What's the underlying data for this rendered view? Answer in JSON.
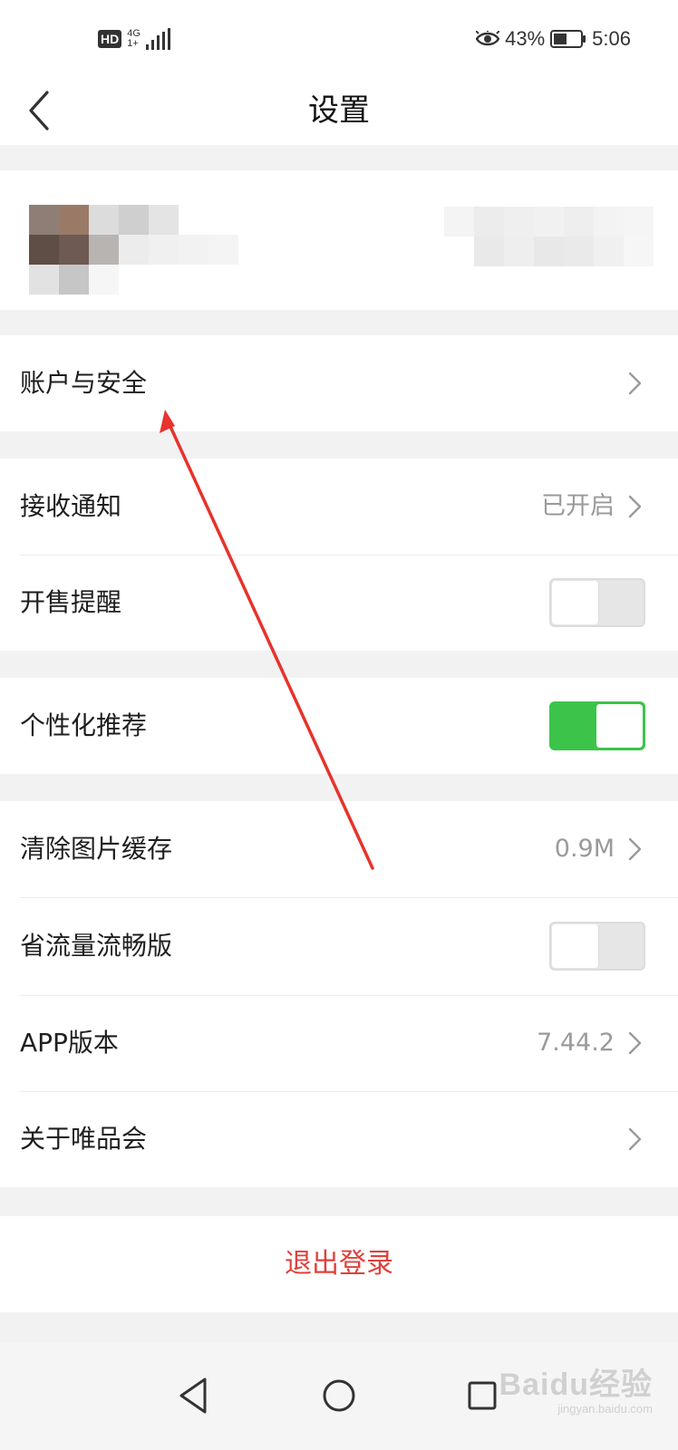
{
  "status_bar": {
    "hd": "HD",
    "network_top": "4G",
    "network_bottom": "1+",
    "battery_percent": "43%",
    "time": "5:06"
  },
  "header": {
    "title": "设置"
  },
  "sections": {
    "account": {
      "label": "账户与安全"
    },
    "notifications": {
      "receive_label": "接收通知",
      "receive_value": "已开启",
      "presale_label": "开售提醒",
      "presale_on": false
    },
    "personalized": {
      "label": "个性化推荐",
      "on": true
    },
    "misc": {
      "cache_label": "清除图片缓存",
      "cache_value": "0.9M",
      "data_saver_label": "省流量流畅版",
      "data_saver_on": false,
      "version_label": "APP版本",
      "version_value": "7.44.2",
      "about_label": "关于唯品会"
    }
  },
  "logout": {
    "label": "退出登录"
  },
  "colors": {
    "accent_red": "#e0403a",
    "toggle_on": "#3cc44a",
    "annotation_arrow": "#e8322c"
  },
  "watermark": {
    "text": "Baidu经验",
    "sub": "jingyan.baidu.com"
  }
}
